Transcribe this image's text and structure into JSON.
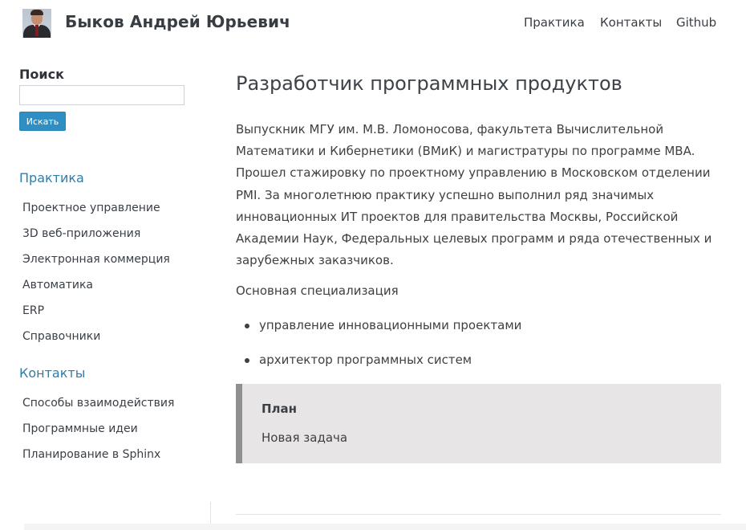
{
  "header": {
    "author_name": "Быков Андрей Юрьевич",
    "avatar_icon": "person-portrait-icon",
    "nav": [
      "Практика",
      "Контакты",
      "Github"
    ]
  },
  "sidebar": {
    "search_title": "Поиск",
    "search_placeholder": "",
    "search_button": "Искать",
    "sections": [
      {
        "caption": "Практика",
        "items": [
          "Проектное управление",
          "3D веб-приложения",
          "Электронная коммерция",
          "Автоматика",
          "ERP",
          "Справочники"
        ]
      },
      {
        "caption": "Контакты",
        "items": [
          "Способы взаимодействия",
          "Программные идеи",
          "Планирование в Sphinx"
        ]
      }
    ]
  },
  "main": {
    "title": "Разработчик программных продуктов",
    "intro": "Выпускник МГУ им. М.В. Ломоносова, факультета Вычислительной Математики и Кибернетики (ВМиК) и магистратуры по программе MBA. Прошел стажировку по проектному управлению в Московском отделении PMI. За многолетнюю практику успешно выполнил ряд значимых инновационных ИТ проектов для правительства Москвы, Российской Академии Наук, Федеральных целевых программ и ряда отечественных и зарубежных заказчиков.",
    "specialization_label": "Основная специализация",
    "specializations": [
      "управление инновационными проектами",
      "архитектор программных систем"
    ],
    "admonition": {
      "title": "План",
      "text": "Новая задача"
    }
  },
  "colors": {
    "link": "#2f7da8",
    "button": "#2f8fc3",
    "admonition_bg": "#e7e5e5",
    "admonition_border": "#8f8f8f"
  }
}
